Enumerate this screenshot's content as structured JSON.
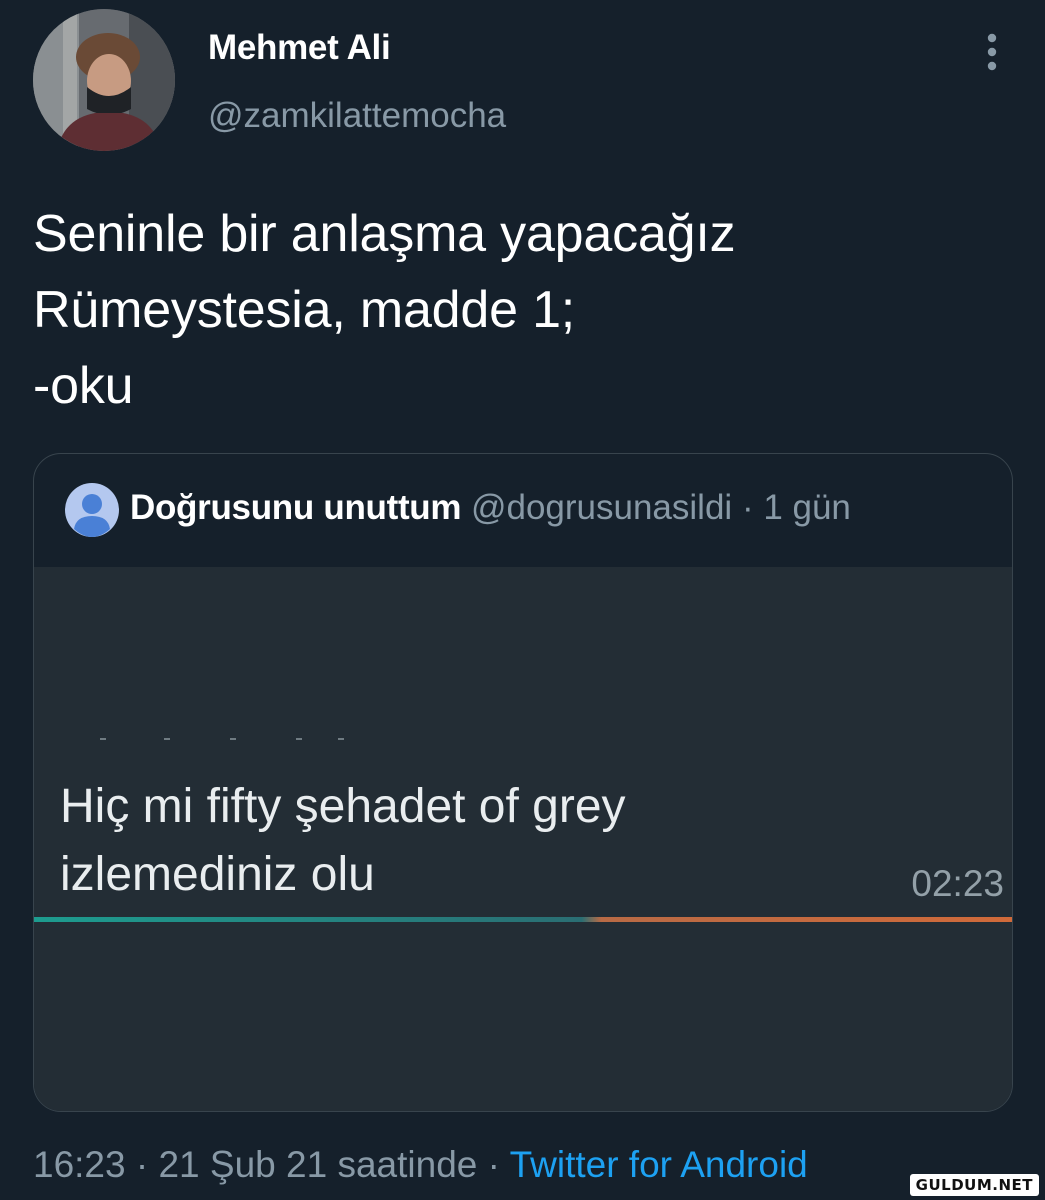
{
  "tweet": {
    "author": {
      "display_name": "Mehmet Ali",
      "handle": "@zamkilattemocha"
    },
    "text_lines": [
      "Seninle bir anlaşma yapacağız",
      "Rümeystesia, madde 1;",
      "-oku"
    ],
    "timestamp": "16:23 · 21 Şub 21 saatinde",
    "separator": " · ",
    "source": "Twitter for Android"
  },
  "quoted_tweet": {
    "display_name": "Doğrusunu unuttum",
    "handle": "@dogrusunasildi",
    "age": "· 1 gün",
    "media": {
      "message_lines": [
        "Hiç mi fifty şehadet of grey",
        "izlemediniz olu"
      ],
      "time": "02:23"
    }
  },
  "icons": {
    "more": "more-vertical-icon",
    "default_avatar": "default-profile-icon"
  },
  "colors": {
    "background": "#15202b",
    "text_primary": "#ffffff",
    "text_secondary": "#8899a6",
    "link": "#1da1f2",
    "card_border": "#38444d"
  },
  "watermark": "GULDUM.NET"
}
